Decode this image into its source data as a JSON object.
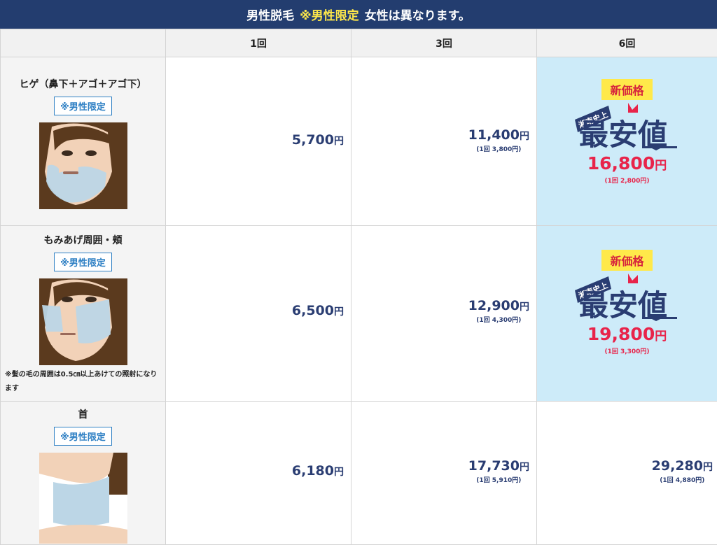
{
  "banner": {
    "title": "男性脱毛",
    "highlight": "※男性限定",
    "note": "女性は異なります。"
  },
  "columns": [
    "",
    "1回",
    "3回",
    "6回"
  ],
  "rows": [
    {
      "area": "ヒゲ（鼻下＋アゴ＋アゴ下）",
      "badge": "※男性限定",
      "note": "",
      "p1": {
        "num": "5,700",
        "yen": "円"
      },
      "p3": {
        "num": "11,400",
        "yen": "円",
        "sub": "(1回 3,800円)"
      },
      "p6": {
        "new_tag": "新価格",
        "stamp_small": "湘南史上",
        "stamp_big": "最安値",
        "num": "16,800",
        "yen": "円",
        "sub": "(1回 2,800円)"
      }
    },
    {
      "area": "もみあげ周囲・頬",
      "badge": "※男性限定",
      "note": "※髪の毛の周囲は0.5㎝以上あけての照射になります",
      "p1": {
        "num": "6,500",
        "yen": "円"
      },
      "p3": {
        "num": "12,900",
        "yen": "円",
        "sub": "(1回 4,300円)"
      },
      "p6": {
        "new_tag": "新価格",
        "stamp_small": "湘南史上",
        "stamp_big": "最安値",
        "num": "19,800",
        "yen": "円",
        "sub": "(1回 3,300円)"
      }
    },
    {
      "area": "首",
      "badge": "※男性限定",
      "note": "",
      "p1": {
        "num": "6,180",
        "yen": "円"
      },
      "p3": {
        "num": "17,730",
        "yen": "円",
        "sub": "(1回 5,910円)"
      },
      "p6": {
        "num": "29,280",
        "yen": "円",
        "sub": "(1回 4,880円)"
      }
    }
  ],
  "colors": {
    "banner": "#233d6f",
    "accent_yellow": "#ffe94a",
    "price_navy": "#2a3d72",
    "price_red": "#e8244a",
    "best_bg": "#cdebf9"
  }
}
